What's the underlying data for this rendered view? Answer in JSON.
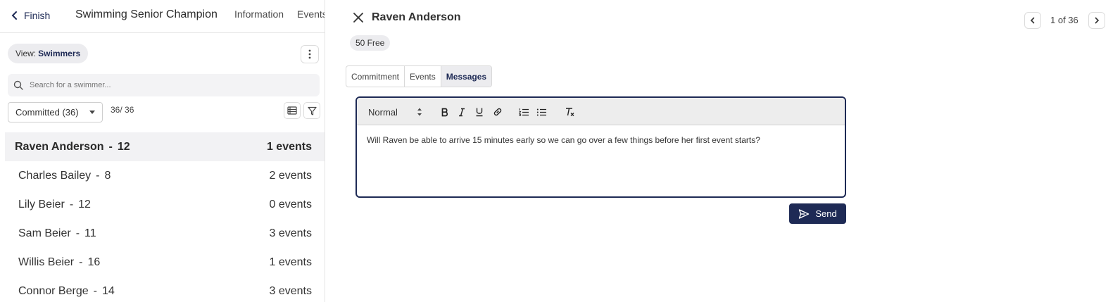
{
  "header": {
    "back_label": "Finish",
    "meet_title": "Swimming Senior Champion",
    "tabs": [
      "Information",
      "Events"
    ]
  },
  "view": {
    "prefix": "View:",
    "value": "Swimmers"
  },
  "search": {
    "placeholder": "Search for a swimmer..."
  },
  "filter": {
    "selected": "Committed (36)",
    "count": "36/ 36"
  },
  "swimmers": [
    {
      "name": "Raven Anderson",
      "age": "12",
      "events": "1 events",
      "active": true
    },
    {
      "name": "Charles Bailey",
      "age": "8",
      "events": "2 events"
    },
    {
      "name": "Lily Beier",
      "age": "12",
      "events": "0 events"
    },
    {
      "name": "Sam Beier",
      "age": "11",
      "events": "3 events"
    },
    {
      "name": "Willis Beier",
      "age": "16",
      "events": "1 events"
    },
    {
      "name": "Connor Berge",
      "age": "14",
      "events": "3 events"
    }
  ],
  "detail": {
    "name": "Raven Anderson",
    "event_chip": "50 Free",
    "pager": "1 of 36",
    "tabs": [
      "Commitment",
      "Events",
      "Messages"
    ],
    "selected_tab": "Messages",
    "format_option": "Normal",
    "message": "Will Raven be able to arrive 15 minutes early so we can go over a few things before her first event starts?",
    "send_label": "Send"
  },
  "colors": {
    "accent": "#1e2a55",
    "pill_bg": "#ececef",
    "active_row": "#f2f2f4"
  }
}
